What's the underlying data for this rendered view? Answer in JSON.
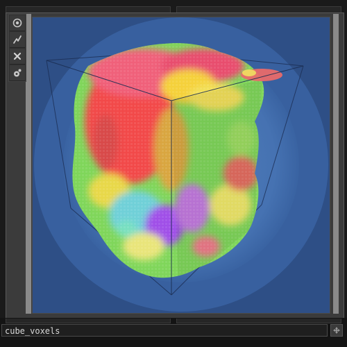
{
  "node": {
    "name": "cube_voxels"
  },
  "toolbar": {
    "buttons": [
      {
        "icon": "view-icon"
      },
      {
        "icon": "wire-icon"
      },
      {
        "icon": "close-icon"
      },
      {
        "icon": "settings-icon"
      }
    ]
  },
  "viewport": {
    "background": "#2e4f86",
    "halo_color": "#5b89c6"
  }
}
